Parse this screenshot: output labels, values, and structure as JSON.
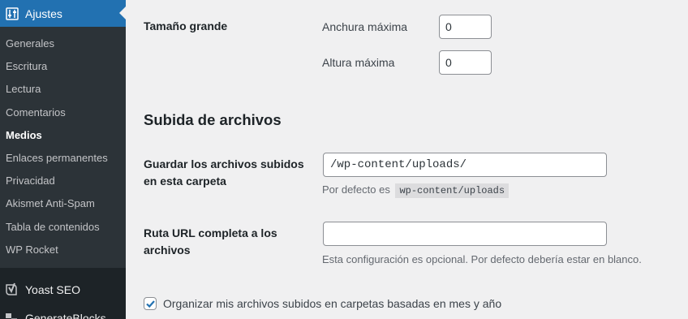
{
  "sidebar": {
    "active_menu": {
      "label": "Ajustes",
      "icon": "settings-sliders-icon"
    },
    "submenu": [
      {
        "label": "Generales",
        "current": false
      },
      {
        "label": "Escritura",
        "current": false
      },
      {
        "label": "Lectura",
        "current": false
      },
      {
        "label": "Comentarios",
        "current": false
      },
      {
        "label": "Medios",
        "current": true
      },
      {
        "label": "Enlaces permanentes",
        "current": false
      },
      {
        "label": "Privacidad",
        "current": false
      },
      {
        "label": "Akismet Anti-Spam",
        "current": false
      },
      {
        "label": "Tabla de contenidos",
        "current": false
      },
      {
        "label": "WP Rocket",
        "current": false
      }
    ],
    "plugins": [
      {
        "label": "Yoast SEO",
        "icon": "yoast-icon"
      },
      {
        "label": "GenerateBlocks",
        "icon": "generateblocks-icon"
      }
    ]
  },
  "large_size": {
    "label": "Tamaño grande",
    "max_width_label": "Anchura máxima",
    "max_width_value": "0",
    "max_height_label": "Altura máxima",
    "max_height_value": "0"
  },
  "uploads": {
    "section_title": "Subida de archivos",
    "folder_label": "Guardar los archivos subidos en esta carpeta",
    "folder_value": "/wp-content/uploads/",
    "folder_default_prefix": "Por defecto es",
    "folder_default_code": "wp-content/uploads",
    "url_label": "Ruta URL completa a los archivos",
    "url_value": "",
    "url_desc": "Esta configuración es opcional. Por defecto debería estar en blanco.",
    "organize_label": "Organizar mis archivos subidos en carpetas basadas en mes y año",
    "organize_checked": true
  },
  "colors": {
    "admin_blue": "#2271b1",
    "sidebar_bg": "#1d2327",
    "submenu_bg": "#2c3338",
    "page_bg": "#f0f0f1"
  }
}
